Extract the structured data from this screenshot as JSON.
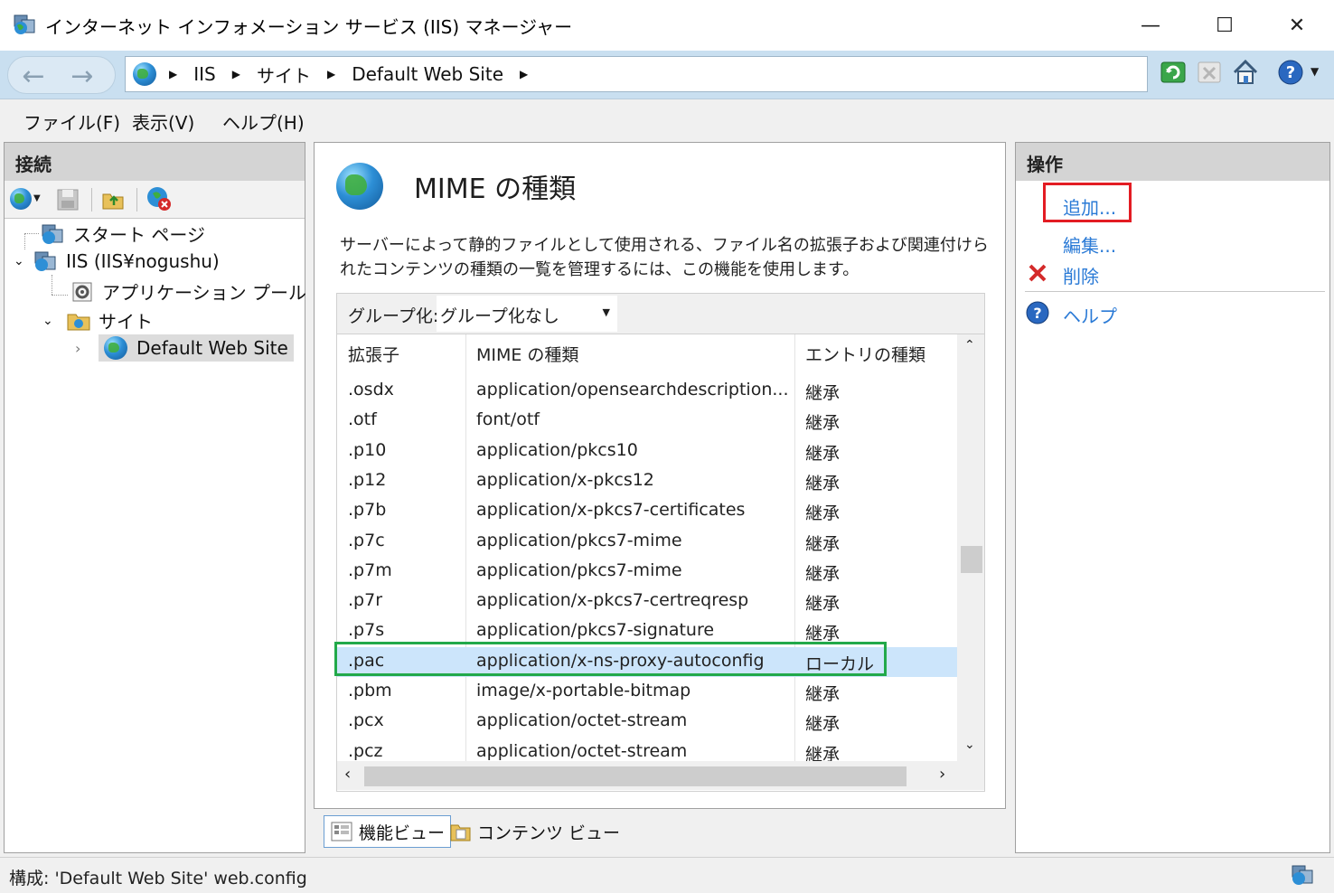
{
  "window": {
    "title": "インターネット インフォメーション サービス (IIS) マネージャー",
    "minimize": "—",
    "maximize": "☐",
    "close": "✕"
  },
  "address": {
    "crumbs": [
      "IIS",
      "サイト",
      "Default Web Site"
    ],
    "sep": "▶"
  },
  "menu": {
    "file": "ファイル(F)",
    "view": "表示(V)",
    "help": "ヘルプ(H)"
  },
  "connections": {
    "title": "接続",
    "tree": {
      "start_page": "スタート ページ",
      "server": "IIS (IIS¥nogushu)",
      "app_pools": "アプリケーション プール",
      "sites": "サイト",
      "default_site": "Default Web Site"
    }
  },
  "feature": {
    "title": "MIME の種類",
    "description": "サーバーによって静的ファイルとして使用される、ファイル名の拡張子および関連付けられたコンテンツの種類の一覧を管理するには、この機能を使用します。",
    "group_label": "グループ化:",
    "group_value": "グループ化なし",
    "columns": [
      "拡張子",
      "MIME の種類",
      "エントリの種類"
    ],
    "rows": [
      {
        "ext": ".osdx",
        "mime": "application/opensearchdescription...",
        "type": "継承"
      },
      {
        "ext": ".otf",
        "mime": "font/otf",
        "type": "継承"
      },
      {
        "ext": ".p10",
        "mime": "application/pkcs10",
        "type": "継承"
      },
      {
        "ext": ".p12",
        "mime": "application/x-pkcs12",
        "type": "継承"
      },
      {
        "ext": ".p7b",
        "mime": "application/x-pkcs7-certificates",
        "type": "継承"
      },
      {
        "ext": ".p7c",
        "mime": "application/pkcs7-mime",
        "type": "継承"
      },
      {
        "ext": ".p7m",
        "mime": "application/pkcs7-mime",
        "type": "継承"
      },
      {
        "ext": ".p7r",
        "mime": "application/x-pkcs7-certreqresp",
        "type": "継承"
      },
      {
        "ext": ".p7s",
        "mime": "application/pkcs7-signature",
        "type": "継承"
      },
      {
        "ext": ".pac",
        "mime": "application/x-ns-proxy-autoconfig",
        "type": "ローカル"
      },
      {
        "ext": ".pbm",
        "mime": "image/x-portable-bitmap",
        "type": "継承"
      },
      {
        "ext": ".pcx",
        "mime": "application/octet-stream",
        "type": "継承"
      },
      {
        "ext": ".pcz",
        "mime": "application/octet-stream",
        "type": "継承"
      }
    ],
    "selected_row": 9
  },
  "view_tabs": {
    "features": "機能ビュー",
    "content": "コンテンツ ビュー"
  },
  "actions": {
    "title": "操作",
    "add": "追加...",
    "edit": "編集...",
    "delete": "削除",
    "help": "ヘルプ"
  },
  "status": {
    "text": "構成: 'Default Web Site' web.config"
  },
  "colors": {
    "accent_link": "#2a7ad6",
    "selected_row": "#cce5fb",
    "highlight_red": "#e31c23",
    "highlight_green": "#22a94a"
  }
}
